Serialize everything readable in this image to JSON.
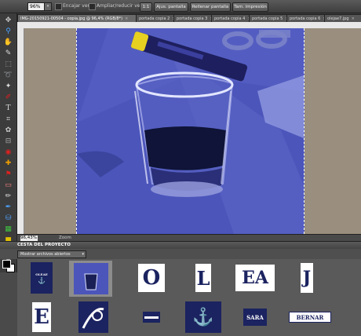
{
  "options_bar": {
    "zoom_value": "96%",
    "check1_label": "Encajar vent.",
    "check2_label": "Ampliar/reducir vent.",
    "btn_11": "1:1",
    "btn_fit": "Ajus. pantalla",
    "btn_fill": "Rellenar pantalla",
    "btn_print": "Tam. impresión"
  },
  "tabs": [
    {
      "label": "IMG-20150921-00504 - copia.jpg @ 96,4% (RGB/8*)"
    },
    {
      "label": "portada copia 2"
    },
    {
      "label": "portada copia 3"
    },
    {
      "label": "portada copia 4"
    },
    {
      "label": "portada copia 5"
    },
    {
      "label": "portada copia 6"
    },
    {
      "label": "olejae7.jpg"
    }
  ],
  "status": {
    "zoom_value": "96,43%",
    "zoom_label": "Zoom"
  },
  "project_bin": {
    "title": "CESTA DEL PROYECTO",
    "show_select": "Mostrar archivos abiertos",
    "thumbs_row1": [
      "OLEAE",
      "",
      "O",
      "L",
      "EA",
      "J"
    ],
    "thumbs_row2": [
      "E",
      "",
      "",
      "",
      "SARA",
      "BERNAR"
    ]
  },
  "colors": {
    "accent": "#4a54b8",
    "thumb_navy": "#1b2360"
  }
}
